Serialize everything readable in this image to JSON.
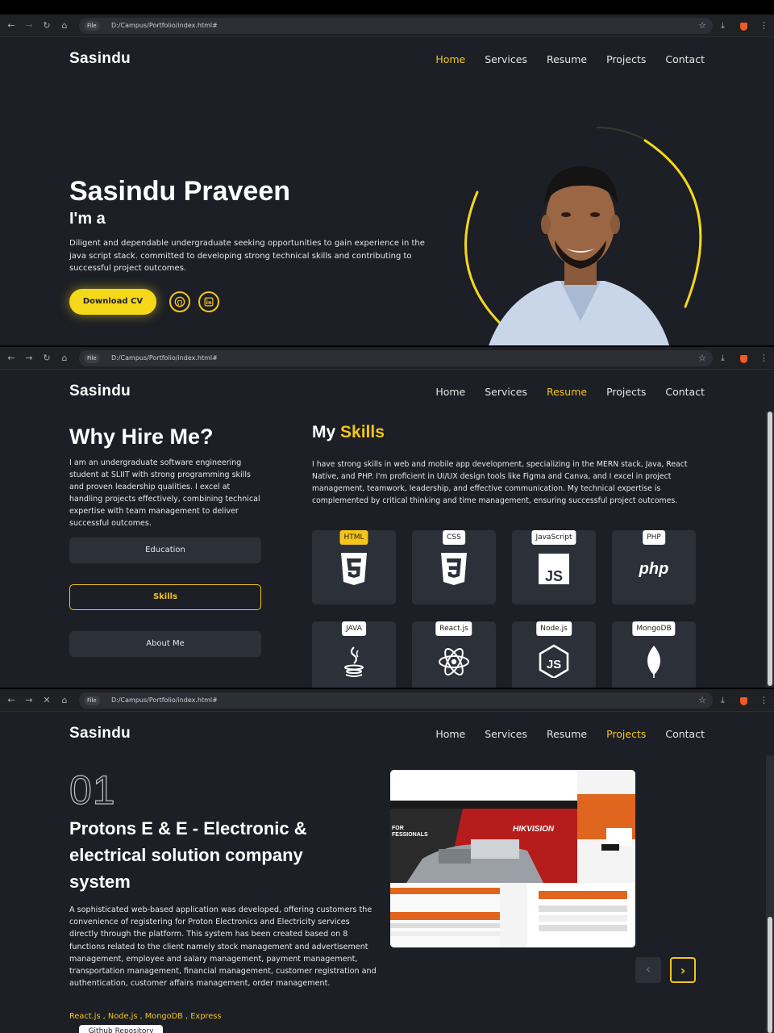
{
  "browser": {
    "file_chip": "File",
    "url": "D:/Campus/Portfolio/index.html#"
  },
  "site": {
    "logo": "Sasindu"
  },
  "nav": {
    "home": "Home",
    "services": "Services",
    "resume": "Resume",
    "projects": "Projects",
    "contact": "Contact"
  },
  "hero": {
    "name": "Sasindu Praveen",
    "subtitle": "I'm a",
    "description": "Diligent and dependable undergraduate seeking opportunities to gain experience in the java script stack. committed to developing strong technical skills and contributing to successful project outcomes.",
    "download_button": "Download CV",
    "github_icon": "github-icon",
    "linkedin_icon": "linkedin-icon"
  },
  "resume": {
    "why_title": "Why Hire Me?",
    "why_description": "I am an undergraduate software engineering student at SLIIT with strong programming skills and proven leadership qualities. I excel at handling projects effectively, combining technical expertise with team management to deliver successful outcomes.",
    "buttons": {
      "education": "Education",
      "skills": "Skills",
      "about": "About Me"
    },
    "skills_title_prefix": "My",
    "skills_title_highlight": "Skills",
    "skills_description": "I have strong skills in web and mobile app development, specializing in the MERN stack, Java, React Native, and PHP. I'm proficient in UI/UX design tools like Figma and Canva, and I excel in project management, teamwork, leadership, and effective communication. My technical expertise is complemented by critical thinking and time management, ensuring successful project outcomes.",
    "skills": [
      {
        "label": "HTML",
        "icon": "html5-icon"
      },
      {
        "label": "CSS",
        "icon": "css3-icon"
      },
      {
        "label": "JavaScript",
        "icon": "javascript-icon"
      },
      {
        "label": "PHP",
        "icon": "php-icon"
      },
      {
        "label": "JAVA",
        "icon": "java-icon"
      },
      {
        "label": "React.js",
        "icon": "react-icon"
      },
      {
        "label": "Node.js",
        "icon": "nodejs-icon"
      },
      {
        "label": "MongoDB",
        "icon": "mongodb-icon"
      }
    ]
  },
  "projects": {
    "number": "01",
    "title": "Protons E & E - Electronic & electrical solution company system",
    "description": "A sophisticated web-based application was developed, offering customers the convenience of registering for Proton Electronics and Electricity services directly through the platform. This system has been created based on 8 functions related to the client namely stock management and advertisement management, employee and salary management, payment management, transportation management, financial management, customer registration and authentication, customer affairs management, order management.",
    "tech": "React.js , Node.js , MongoDB , Express",
    "repo_button": "Github Repository",
    "screenshot_banner_left": "FOR\nFESSIONALS",
    "screenshot_banner_brand": "HIKVISION",
    "prev_icon": "chevron-left-icon",
    "next_icon": "chevron-right-icon"
  },
  "colors": {
    "accent": "#f5c518",
    "background": "#1c1f26",
    "card": "#2b3039"
  }
}
